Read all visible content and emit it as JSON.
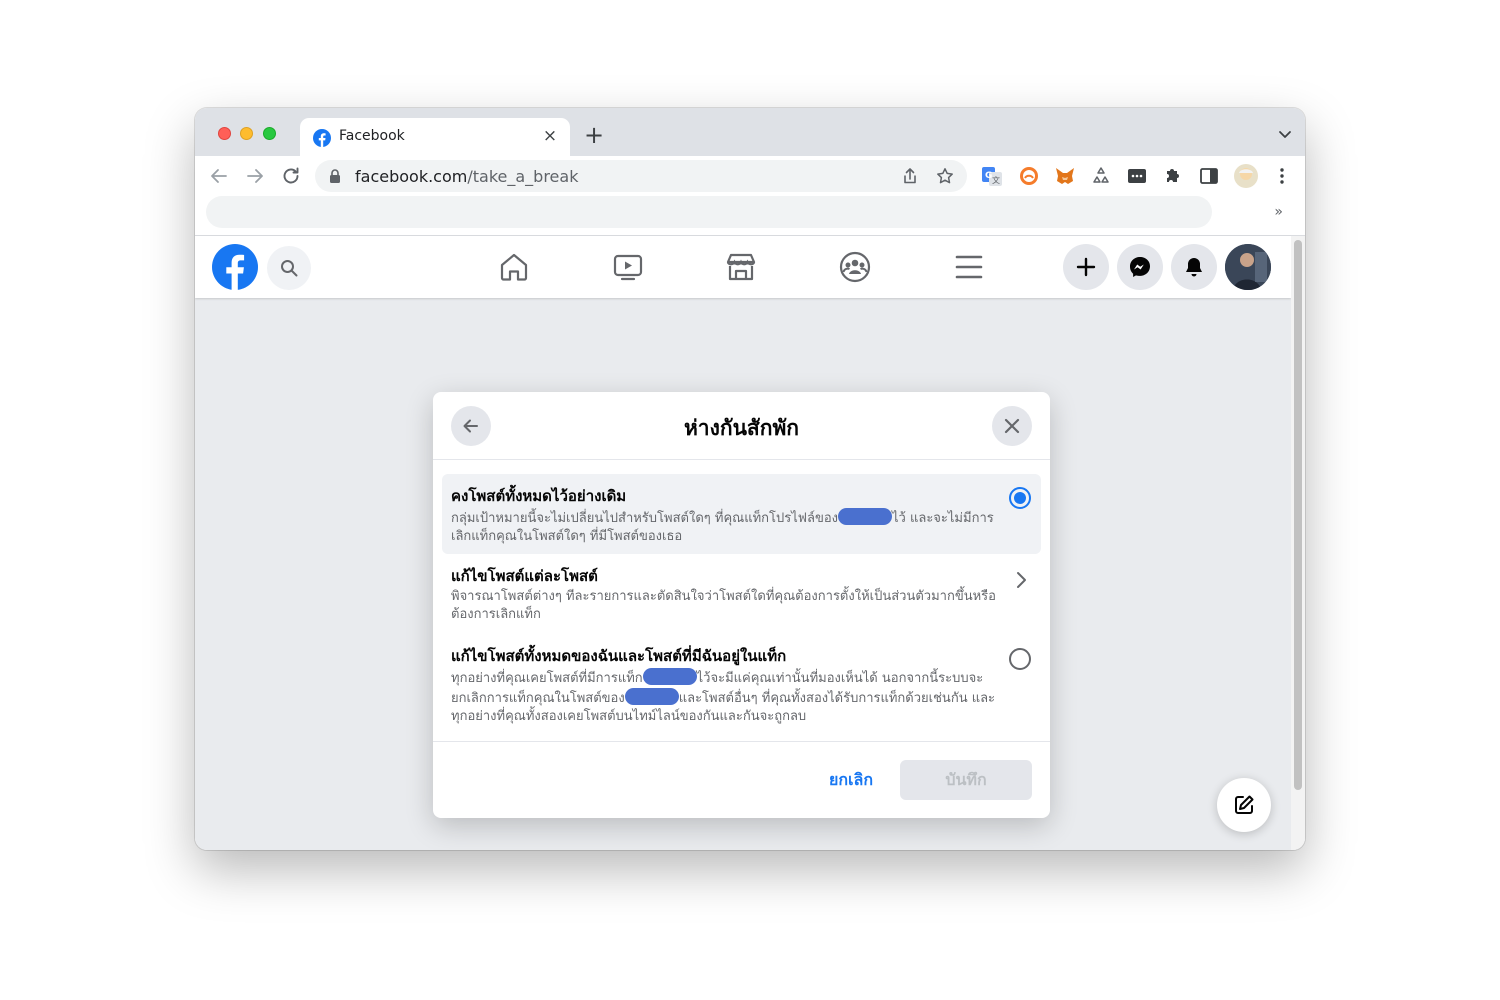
{
  "browser": {
    "tab_title": "Facebook",
    "url_domain": "facebook.com",
    "url_path": "/take_a_break",
    "new_tab_symbol": "+",
    "tab_close_symbol": "×",
    "bookmarks_overflow": "»"
  },
  "icons": {
    "tab_favicon": "facebook-icon",
    "nav": [
      "home-icon",
      "watch-icon",
      "marketplace-icon",
      "groups-icon",
      "menu-icon"
    ],
    "actions": [
      "plus-icon",
      "messenger-icon",
      "notifications-icon"
    ],
    "extensions": [
      "google-translate-icon",
      "tracker-icon",
      "metamask-icon",
      "recycle-icon",
      "password-icon",
      "puzzle-icon",
      "sidebar-icon",
      "profile-icon",
      "kebab-menu-icon"
    ]
  },
  "dialog": {
    "title": "ห่างกันสักพัก",
    "options": [
      {
        "title": "คงโพสต์ทั้งหมดไว้อย่างเดิม",
        "desc_parts": [
          "กลุ่มเป้าหมายนี้จะไม่เปลี่ยนไปสำหรับโพสต์ใดๆ ที่คุณแท็กโปรไฟล์ของ",
          "ไว้ และจะไม่มีการเลิกแท็กคุณในโพสต์ใดๆ ที่มีโพสต์ของเธอ"
        ],
        "selected": true
      },
      {
        "title": "แก้ไขโพสต์แต่ละโพสต์",
        "desc": "พิจารณาโพสต์ต่างๆ ทีละรายการและตัดสินใจว่าโพสต์ใดที่คุณต้องการตั้งให้เป็นส่วนตัวมากขึ้นหรือต้องการเลิกแท็ก",
        "selected": false
      },
      {
        "title": "แก้ไขโพสต์ทั้งหมดของฉันและโพสต์ที่มีฉันอยู่ในแท็ก",
        "desc_parts": [
          "ทุกอย่างที่คุณเคยโพสต์ที่มีการแท็ก",
          "ไว้จะมีแค่คุณเท่านั้นที่มองเห็นได้ นอกจากนี้ระบบจะยกเลิกการแท็กคุณในโพสต์ของ",
          "และโพสต์อื่นๆ ที่คุณทั้งสองได้รับการแท็กด้วยเช่นกัน และทุกอย่างที่คุณทั้งสองเคยโพสต์บนไทม์ไลน์ของกันและกันจะถูกลบ"
        ],
        "selected": false
      }
    ],
    "cancel_label": "ยกเลิก",
    "save_label": "บันทึก"
  },
  "colors": {
    "facebook_blue": "#1877f2",
    "redaction": "#4a70cf",
    "page_bg": "#e9ebee"
  }
}
